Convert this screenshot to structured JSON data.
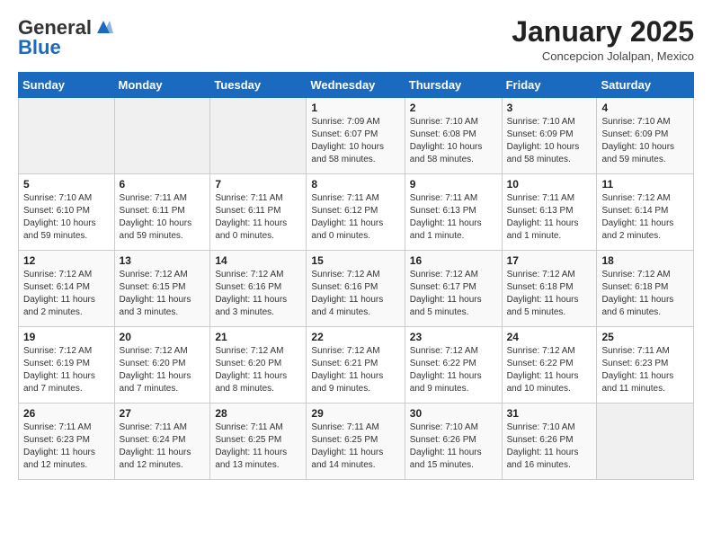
{
  "header": {
    "logo_general": "General",
    "logo_blue": "Blue",
    "month_title": "January 2025",
    "location": "Concepcion Jolalpan, Mexico"
  },
  "days_of_week": [
    "Sunday",
    "Monday",
    "Tuesday",
    "Wednesday",
    "Thursday",
    "Friday",
    "Saturday"
  ],
  "weeks": [
    [
      {
        "day": "",
        "info": ""
      },
      {
        "day": "",
        "info": ""
      },
      {
        "day": "",
        "info": ""
      },
      {
        "day": "1",
        "info": "Sunrise: 7:09 AM\nSunset: 6:07 PM\nDaylight: 10 hours\nand 58 minutes."
      },
      {
        "day": "2",
        "info": "Sunrise: 7:10 AM\nSunset: 6:08 PM\nDaylight: 10 hours\nand 58 minutes."
      },
      {
        "day": "3",
        "info": "Sunrise: 7:10 AM\nSunset: 6:09 PM\nDaylight: 10 hours\nand 58 minutes."
      },
      {
        "day": "4",
        "info": "Sunrise: 7:10 AM\nSunset: 6:09 PM\nDaylight: 10 hours\nand 59 minutes."
      }
    ],
    [
      {
        "day": "5",
        "info": "Sunrise: 7:10 AM\nSunset: 6:10 PM\nDaylight: 10 hours\nand 59 minutes."
      },
      {
        "day": "6",
        "info": "Sunrise: 7:11 AM\nSunset: 6:11 PM\nDaylight: 10 hours\nand 59 minutes."
      },
      {
        "day": "7",
        "info": "Sunrise: 7:11 AM\nSunset: 6:11 PM\nDaylight: 11 hours\nand 0 minutes."
      },
      {
        "day": "8",
        "info": "Sunrise: 7:11 AM\nSunset: 6:12 PM\nDaylight: 11 hours\nand 0 minutes."
      },
      {
        "day": "9",
        "info": "Sunrise: 7:11 AM\nSunset: 6:13 PM\nDaylight: 11 hours\nand 1 minute."
      },
      {
        "day": "10",
        "info": "Sunrise: 7:11 AM\nSunset: 6:13 PM\nDaylight: 11 hours\nand 1 minute."
      },
      {
        "day": "11",
        "info": "Sunrise: 7:12 AM\nSunset: 6:14 PM\nDaylight: 11 hours\nand 2 minutes."
      }
    ],
    [
      {
        "day": "12",
        "info": "Sunrise: 7:12 AM\nSunset: 6:14 PM\nDaylight: 11 hours\nand 2 minutes."
      },
      {
        "day": "13",
        "info": "Sunrise: 7:12 AM\nSunset: 6:15 PM\nDaylight: 11 hours\nand 3 minutes."
      },
      {
        "day": "14",
        "info": "Sunrise: 7:12 AM\nSunset: 6:16 PM\nDaylight: 11 hours\nand 3 minutes."
      },
      {
        "day": "15",
        "info": "Sunrise: 7:12 AM\nSunset: 6:16 PM\nDaylight: 11 hours\nand 4 minutes."
      },
      {
        "day": "16",
        "info": "Sunrise: 7:12 AM\nSunset: 6:17 PM\nDaylight: 11 hours\nand 5 minutes."
      },
      {
        "day": "17",
        "info": "Sunrise: 7:12 AM\nSunset: 6:18 PM\nDaylight: 11 hours\nand 5 minutes."
      },
      {
        "day": "18",
        "info": "Sunrise: 7:12 AM\nSunset: 6:18 PM\nDaylight: 11 hours\nand 6 minutes."
      }
    ],
    [
      {
        "day": "19",
        "info": "Sunrise: 7:12 AM\nSunset: 6:19 PM\nDaylight: 11 hours\nand 7 minutes."
      },
      {
        "day": "20",
        "info": "Sunrise: 7:12 AM\nSunset: 6:20 PM\nDaylight: 11 hours\nand 7 minutes."
      },
      {
        "day": "21",
        "info": "Sunrise: 7:12 AM\nSunset: 6:20 PM\nDaylight: 11 hours\nand 8 minutes."
      },
      {
        "day": "22",
        "info": "Sunrise: 7:12 AM\nSunset: 6:21 PM\nDaylight: 11 hours\nand 9 minutes."
      },
      {
        "day": "23",
        "info": "Sunrise: 7:12 AM\nSunset: 6:22 PM\nDaylight: 11 hours\nand 9 minutes."
      },
      {
        "day": "24",
        "info": "Sunrise: 7:12 AM\nSunset: 6:22 PM\nDaylight: 11 hours\nand 10 minutes."
      },
      {
        "day": "25",
        "info": "Sunrise: 7:11 AM\nSunset: 6:23 PM\nDaylight: 11 hours\nand 11 minutes."
      }
    ],
    [
      {
        "day": "26",
        "info": "Sunrise: 7:11 AM\nSunset: 6:23 PM\nDaylight: 11 hours\nand 12 minutes."
      },
      {
        "day": "27",
        "info": "Sunrise: 7:11 AM\nSunset: 6:24 PM\nDaylight: 11 hours\nand 12 minutes."
      },
      {
        "day": "28",
        "info": "Sunrise: 7:11 AM\nSunset: 6:25 PM\nDaylight: 11 hours\nand 13 minutes."
      },
      {
        "day": "29",
        "info": "Sunrise: 7:11 AM\nSunset: 6:25 PM\nDaylight: 11 hours\nand 14 minutes."
      },
      {
        "day": "30",
        "info": "Sunrise: 7:10 AM\nSunset: 6:26 PM\nDaylight: 11 hours\nand 15 minutes."
      },
      {
        "day": "31",
        "info": "Sunrise: 7:10 AM\nSunset: 6:26 PM\nDaylight: 11 hours\nand 16 minutes."
      },
      {
        "day": "",
        "info": ""
      }
    ]
  ]
}
